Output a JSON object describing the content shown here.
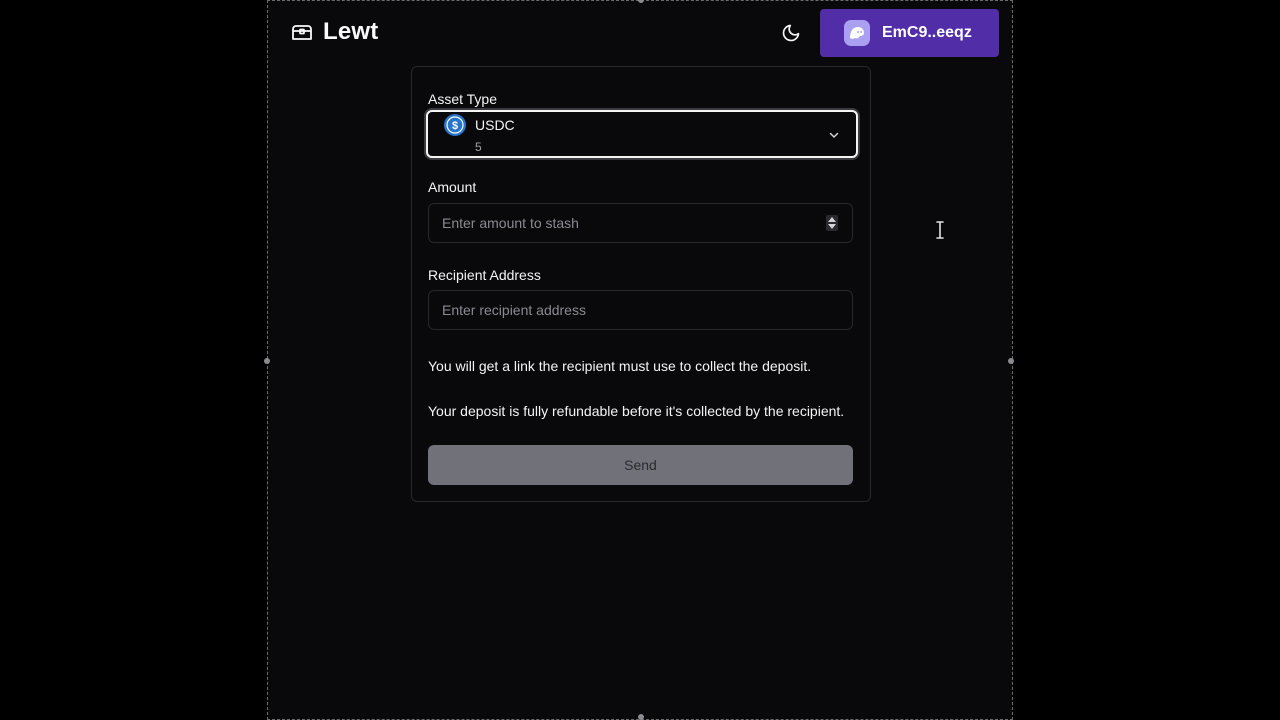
{
  "app": {
    "name": "Lewt"
  },
  "header": {
    "theme_icon": "moon-icon",
    "wallet_label": "EmC9..eeqz",
    "wallet_icon": "phantom-ghost-icon"
  },
  "form": {
    "asset_type_label": "Asset Type",
    "asset": {
      "name": "USDC",
      "balance": "5",
      "icon": "usdc-icon"
    },
    "amount_label": "Amount",
    "amount_placeholder": "Enter amount to stash",
    "recipient_label": "Recipient Address",
    "recipient_placeholder": "Enter recipient address",
    "note_1": "You will get a link the recipient must use to collect the deposit.",
    "note_2": "Your deposit is fully refundable before it's collected by the recipient.",
    "send_label": "Send"
  },
  "colors": {
    "wallet": "#512da8",
    "send_disabled": "#71717a",
    "usdc": "#2775ca",
    "background": "#09090b"
  }
}
